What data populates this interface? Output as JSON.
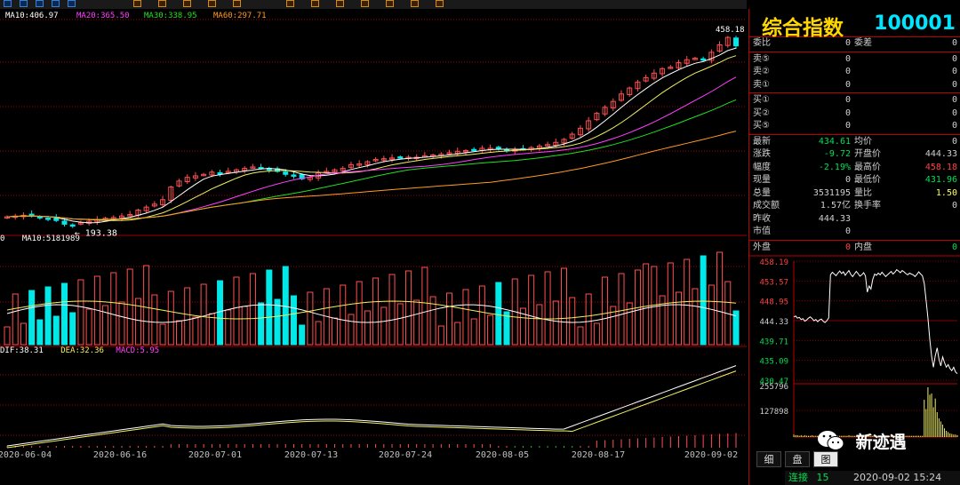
{
  "toolbar": {
    "icons": [
      "toolbar-icon-1",
      "toolbar-icon-2",
      "toolbar-icon-3",
      "toolbar-icon-4",
      "toolbar-icon-5",
      "toolbar-icon-6",
      "toolbar-icon-7",
      "toolbar-icon-8",
      "toolbar-icon-9",
      "toolbar-icon-10",
      "toolbar-icon-11",
      "toolbar-icon-12",
      "toolbar-icon-13",
      "toolbar-icon-14",
      "toolbar-icon-15",
      "toolbar-icon-16",
      "toolbar-icon-17"
    ]
  },
  "ma_legend": [
    {
      "text": "MA10:406.97",
      "color": "#ffffff"
    },
    {
      "text": "MA20:365.50",
      "color": "#ff40ff"
    },
    {
      "text": "MA30:338.95",
      "color": "#20e020"
    },
    {
      "text": "MA60:297.71",
      "color": "#ff9a20"
    }
  ],
  "vol_legend": {
    "left": "0",
    "ma10": "MA10:5181989"
  },
  "macd_legend": {
    "dif": "DIF:38.31",
    "dea": "DEA:32.36",
    "macd": "MACD:5.95"
  },
  "colors": {
    "up": "#ff5050",
    "down": "#00e8e8",
    "grid": "#a00000",
    "ma5": "#ffffff",
    "ma10": "#f0f060",
    "ma20": "#ff40ff",
    "ma30": "#20e020",
    "ma60": "#ff9a20"
  },
  "low_label": "193.38",
  "high_label": "458.18",
  "chart_data": {
    "type": "line",
    "x_dates": [
      "2020-06-04",
      "2020-06-16",
      "2020-07-01",
      "2020-07-13",
      "2020-07-24",
      "2020-08-05",
      "2020-08-17",
      "2020-09-02"
    ],
    "price_ylim": [
      180,
      470
    ],
    "price_close": [
      205,
      206,
      207,
      206,
      204,
      203,
      200,
      195,
      194,
      197,
      199,
      201,
      203,
      204,
      206,
      208,
      214,
      218,
      222,
      228,
      245,
      253,
      258,
      260,
      262,
      265,
      263,
      266,
      268,
      270,
      272,
      271,
      268,
      266,
      262,
      260,
      256,
      258,
      264,
      266,
      268,
      270,
      275,
      276,
      279,
      282,
      283,
      284,
      284,
      285,
      285,
      287,
      288,
      289,
      291,
      293,
      294,
      295,
      297,
      297,
      296,
      294,
      295,
      296,
      298,
      300,
      302,
      305,
      309,
      316,
      324,
      334,
      344,
      352,
      360,
      370,
      378,
      386,
      392,
      398,
      404,
      406,
      412,
      416,
      418,
      416,
      426,
      436,
      446,
      434.61
    ],
    "vol_ma10": "5181989",
    "macd": {
      "dif": 38.31,
      "dea": 32.36,
      "macd": 5.95
    }
  },
  "quote": {
    "name": "综合指数",
    "code": "100001",
    "top": [
      {
        "l1": "委比",
        "v1": "0",
        "l2": "委差",
        "v2": "0"
      }
    ],
    "asks": [
      {
        "l": "卖⑤",
        "v": "0",
        "v2": "0"
      },
      {
        "l": "卖②",
        "v": "0",
        "v2": "0"
      },
      {
        "l": "卖①",
        "v": "0",
        "v2": "0"
      }
    ],
    "bids": [
      {
        "l": "买①",
        "v": "0",
        "v2": "0"
      },
      {
        "l": "买②",
        "v": "0",
        "v2": "0"
      },
      {
        "l": "买⑤",
        "v": "0",
        "v2": "0"
      }
    ],
    "stats": [
      {
        "l1": "最新",
        "v1": "434.61",
        "c1": "#00e050",
        "l2": "均价",
        "v2": "0",
        "c2": "#d0d0d0"
      },
      {
        "l1": "涨跌",
        "v1": "-9.72",
        "c1": "#00e050",
        "l2": "开盘价",
        "v2": "444.33",
        "c2": "#d0d0d0"
      },
      {
        "l1": "幅度",
        "v1": "-2.19%",
        "c1": "#00e050",
        "l2": "最高价",
        "v2": "458.18",
        "c2": "#ff4040"
      },
      {
        "l1": "现量",
        "v1": "0",
        "c1": "#d0d0d0",
        "l2": "最低价",
        "v2": "431.96",
        "c2": "#00e050"
      },
      {
        "l1": "总量",
        "v1": "3531195",
        "c1": "#d0d0d0",
        "l2": "量比",
        "v2": "1.50",
        "c2": "#ffff60"
      },
      {
        "l1": "成交额",
        "v1": "1.57亿",
        "c1": "#d0d0d0",
        "l2": "换手率",
        "v2": "0",
        "c2": "#d0d0d0"
      },
      {
        "l1": "昨收",
        "v1": "444.33",
        "c1": "#d0d0d0",
        "l2": "",
        "v2": "",
        "c2": "#d0d0d0"
      },
      {
        "l1": "市值",
        "v1": "0",
        "c1": "#d0d0d0",
        "l2": "",
        "v2": "",
        "c2": "#d0d0d0"
      }
    ],
    "outer": {
      "l1": "外盘",
      "v1": "0",
      "l2": "内盘",
      "v2": "0"
    }
  },
  "intraday": {
    "price_labels": [
      "458.19",
      "453.57",
      "448.95",
      "444.33",
      "439.71",
      "435.09",
      "430.47"
    ],
    "volume_labels": [
      "255796",
      "127898"
    ],
    "prices": [
      445.2,
      445.4,
      444.9,
      445.1,
      444.6,
      444.8,
      444.2,
      444.5,
      444.9,
      445.2,
      444.8,
      444.3,
      444.6,
      444.1,
      444.5,
      444.7,
      444.2,
      443.9,
      444.3,
      445.0,
      455.0,
      455.6,
      455.2,
      454.8,
      455.4,
      455.9,
      455.3,
      455.7,
      454.9,
      455.5,
      456.0,
      455.1,
      454.6,
      455.2,
      455.8,
      455.3,
      454.7,
      455.0,
      455.5,
      454.8,
      451.0,
      452.4,
      451.7,
      454.0,
      455.2,
      454.9,
      455.4,
      455.0,
      455.6,
      455.1,
      454.6,
      455.0,
      455.4,
      455.8,
      455.2,
      455.6,
      456.2,
      455.9,
      455.5,
      456.0,
      455.7,
      455.3,
      455.0,
      455.4,
      455.2,
      455.0,
      454.6,
      455.1,
      455.7,
      455.2,
      454.8,
      453.0,
      449.0,
      445.0,
      440.0,
      436.0,
      433.5,
      436.2,
      438.0,
      435.4,
      433.8,
      435.9,
      434.6,
      433.5,
      434.1,
      433.2,
      432.7,
      433.5,
      432.4,
      432.0
    ],
    "volumes": [
      4,
      3,
      3,
      2,
      3,
      2,
      3,
      2,
      2,
      2,
      3,
      2,
      2,
      2,
      2,
      2,
      2,
      2,
      2,
      2,
      2,
      2,
      2,
      2,
      2,
      2,
      2,
      2,
      2,
      2,
      3,
      2,
      2,
      2,
      2,
      2,
      2,
      2,
      2,
      2,
      2,
      2,
      2,
      2,
      2,
      2,
      2,
      2,
      2,
      2,
      2,
      2,
      2,
      2,
      2,
      2,
      2,
      2,
      2,
      2,
      2,
      2,
      2,
      2,
      2,
      2,
      2,
      2,
      2,
      2,
      2,
      60,
      45,
      80,
      68,
      70,
      48,
      62,
      40,
      30,
      25,
      20,
      14,
      10,
      8,
      6,
      5,
      4,
      4,
      3
    ]
  },
  "tabs": [
    "细",
    "盘",
    "图"
  ],
  "status": {
    "label": "连接",
    "count": "15",
    "datetime": "2020-09-02 15:24"
  },
  "watermark": "新迹遇"
}
